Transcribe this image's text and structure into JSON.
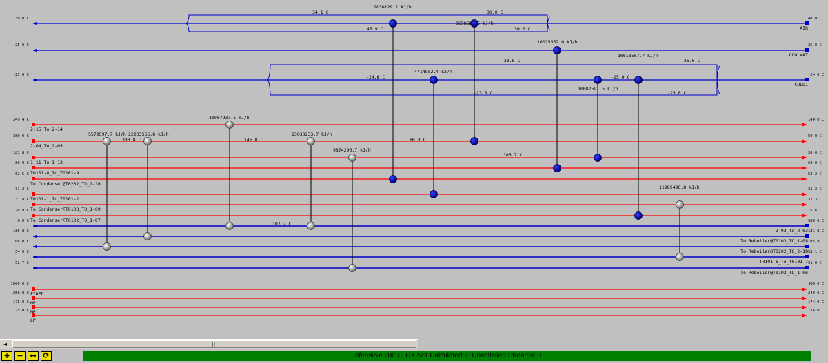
{
  "streams": [
    {
      "kind": "util",
      "name": "AIR",
      "t_in": "40.0 C",
      "t_out": "30.0 C",
      "color": "#0000cc"
    },
    {
      "kind": "util",
      "name": "COOLWAT",
      "t_in": "35.0 C",
      "t_out": "25.0 C",
      "color": "#0000cc"
    },
    {
      "kind": "util",
      "name": "COLD1",
      "t_in": "-24.0 C",
      "t_out": "-25.0 C",
      "color": "#0000cc"
    },
    {
      "kind": "hot",
      "name": "2-15_To_2-14",
      "t_in": "349.4 C",
      "t_out": "140.0 C",
      "color": "#ff0000"
    },
    {
      "kind": "hot",
      "name": "2-04_To_2-05",
      "t_in": "380.0 C",
      "t_out": "50.0 C",
      "color": "#ff0000"
    },
    {
      "kind": "hot",
      "name": "1-11_To_1-12",
      "t_in": "181.8 C",
      "t_out": "30.0 C",
      "color": "#ff0000"
    },
    {
      "kind": "hot",
      "name": "T0101-8_To_T0101-9",
      "t_in": "80.9 C",
      "t_out": "60.0 C",
      "color": "#ff0000"
    },
    {
      "kind": "hot",
      "name": "To Condenser@T0202_TO_2-16",
      "t_in": "62.5 C",
      "t_out": "52.2 C",
      "color": "#ff0000"
    },
    {
      "kind": "hot",
      "name": "T0101-1_To_T0101-2",
      "t_in": "31.2 C",
      "t_out": "31.2 C",
      "color": "#ff0000"
    },
    {
      "kind": "hot",
      "name": "To Condenser@T0103_TO_1-09",
      "t_in": "31.8 C",
      "t_out": "31.3 C",
      "color": "#ff0000"
    },
    {
      "kind": "hot",
      "name": "To Condenser@T0102_TO_1-07",
      "t_in": "26.9 C",
      "t_out": "15.6 C",
      "color": "#ff0000"
    },
    {
      "kind": "cold",
      "name": "2-02_To_2-03",
      "t_in": "380.0 C",
      "t_out": "0.0 C",
      "color": "#0000cc"
    },
    {
      "kind": "cold",
      "name": "To Reboiler@T0103_TO_1-08",
      "t_in": "181.8 C",
      "t_out": "185.8 C",
      "color": "#0000cc"
    },
    {
      "kind": "cold",
      "name": "To Reboiler@T0202_TO_2-18",
      "t_in": "105.9 C",
      "t_out": "106.0 C",
      "color": "#0000cc"
    },
    {
      "kind": "cold",
      "name": "T0101-6_To_T0101-7",
      "t_in": "53.1 C",
      "t_out": "54.0 C",
      "color": "#0000cc"
    },
    {
      "kind": "cold",
      "name": "To Reboiler@T0102_TO_1-06",
      "t_in": "51.0 C",
      "t_out": "52.7 C",
      "color": "#0000cc"
    },
    {
      "kind": "util2",
      "name": "FIRED",
      "t_in": "1000.0 C",
      "t_out": "400.0 C",
      "color": "#ff0000"
    },
    {
      "kind": "util2",
      "name": "HP",
      "t_in": "250.0 C",
      "t_out": "249.0 C",
      "color": "#ff0000"
    },
    {
      "kind": "util2",
      "name": "MP",
      "t_in": "175.0 C",
      "t_out": "174.0 C",
      "color": "#ff0000"
    },
    {
      "kind": "util2",
      "name": "LP",
      "t_in": "125.0 C",
      "t_out": "124.0 C",
      "color": "#ff0000"
    }
  ],
  "exchangers": [
    {
      "duty": "2830129.2 kJ/h",
      "style": "blue",
      "a": 0,
      "b": 7
    },
    {
      "duty": "9658563.5 kJ/h",
      "style": "blue",
      "a": 0,
      "b": 4
    },
    {
      "duty": "16025552.0 kJ/h",
      "style": "blue",
      "a": 1,
      "b": 6
    },
    {
      "duty": "10618587.7 kJ/h",
      "style": "blue",
      "a": 2,
      "b": 10
    },
    {
      "duty": "4714552.4 kJ/h",
      "style": "blue",
      "a": 2,
      "b": 8
    },
    {
      "duty": "10082591.5 kJ/h",
      "style": "blue",
      "a": 2,
      "b": 5
    },
    {
      "duty": "30007937.5 kJ/h",
      "style": "gray",
      "a": 3,
      "b": 11
    },
    {
      "duty": "5579597.7 kJ/h",
      "style": "gray",
      "a": 4,
      "b": 13
    },
    {
      "duty": "22203565.8 kJ/h",
      "style": "gray",
      "a": 4,
      "b": 12
    },
    {
      "duty": "23030233.7 kJ/h",
      "style": "gray",
      "a": 4,
      "b": 11
    },
    {
      "duty": "9874296.7 kJ/h",
      "style": "gray",
      "a": 5,
      "b": 15
    },
    {
      "duty": "11989496.8 kJ/h",
      "style": "gray",
      "a": 9,
      "b": 14
    }
  ],
  "temp_labels": [
    "34.1 C",
    "30.0 C",
    "45.9 C",
    "30.0 C",
    "-23.6 C",
    "-25.0 C",
    "-24.6 C",
    "-25.0 C",
    "-23.0 C",
    "-25.0 C",
    "333.8 C",
    "145.8 C",
    "80.3 C",
    "106.7 C",
    "107.7 C"
  ],
  "scrollbar": {
    "left_arrow": "◄",
    "right_arrow": "►",
    "thumb_grip": "|||"
  },
  "toolbar": {
    "zoom_in": "+",
    "zoom_out": "−",
    "fit": "↔",
    "refresh": "⟳"
  },
  "status": "Infeasible HX: 0, HX Not Calculated: 0     Unsatisfied Streams: 0"
}
